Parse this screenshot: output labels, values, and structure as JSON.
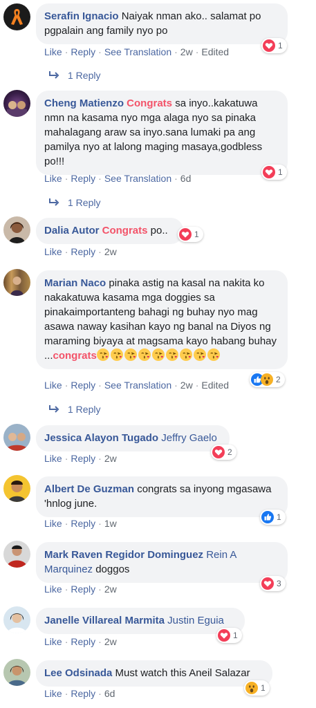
{
  "labels": {
    "like": "Like",
    "reply": "Reply",
    "see_translation": "See Translation",
    "edited": "Edited",
    "dot": "·"
  },
  "comments": [
    {
      "author": "Serafin Ignacio",
      "text": "Naiyak nman ako.. salamat po pgpalain ang family nyo po",
      "time": "2w",
      "reactions": "1",
      "replies": "1 Reply"
    },
    {
      "author": "Cheng Matienzo",
      "highlight": "Congrats",
      "text": "sa inyo..kakatuwa nmn na kasama nyo mga alaga nyo sa pinaka mahalagang araw sa inyo.sana lumaki pa ang pamilya nyo at lalong maging masaya,godbless po!!!",
      "time": "6d",
      "reactions": "1",
      "replies": "1 Reply"
    },
    {
      "author": "Dalia Autor",
      "highlight": "Congrats",
      "text": "po..",
      "time": "2w",
      "reactions": "1"
    },
    {
      "author": "Marian Naco",
      "text": "pinaka astig na kasal na nakita ko nakakatuwa kasama mga doggies sa pinakaimportanteng bahagi ng buhay nyo mag asawa naway kasihan kayo ng banal na Diyos ng maraming biyaya at magsama kayo habang buhay ...",
      "highlight": "congrats",
      "time": "2w",
      "reactions": "2",
      "replies": "1 Reply"
    },
    {
      "author": "Jessica Alayon Tugado",
      "tag": "Jeffry Gaelo",
      "time": "2w",
      "reactions": "2"
    },
    {
      "author": "Albert De Guzman",
      "text": "congrats sa inyong mgasawa 'hnlog june.",
      "time": "1w",
      "reactions": "1"
    },
    {
      "author": "Mark Raven Regidor Dominguez",
      "tag": "Rein A Marquinez",
      "text": "doggos",
      "time": "2w",
      "reactions": "3"
    },
    {
      "author": "Janelle Villareal Marmita",
      "tag": "Justin Eguia",
      "time": "2w",
      "reactions": "1"
    },
    {
      "author": "Lee Odsinada",
      "text": "Must watch this Aneil Salazar",
      "time": "6d",
      "reactions": "1"
    }
  ],
  "colors": {
    "link": "#385898",
    "congrats": "#f35369",
    "bubble": "#f2f3f5",
    "love": "#f33e58",
    "like": "#1877f2",
    "wow": "#f7b125"
  }
}
